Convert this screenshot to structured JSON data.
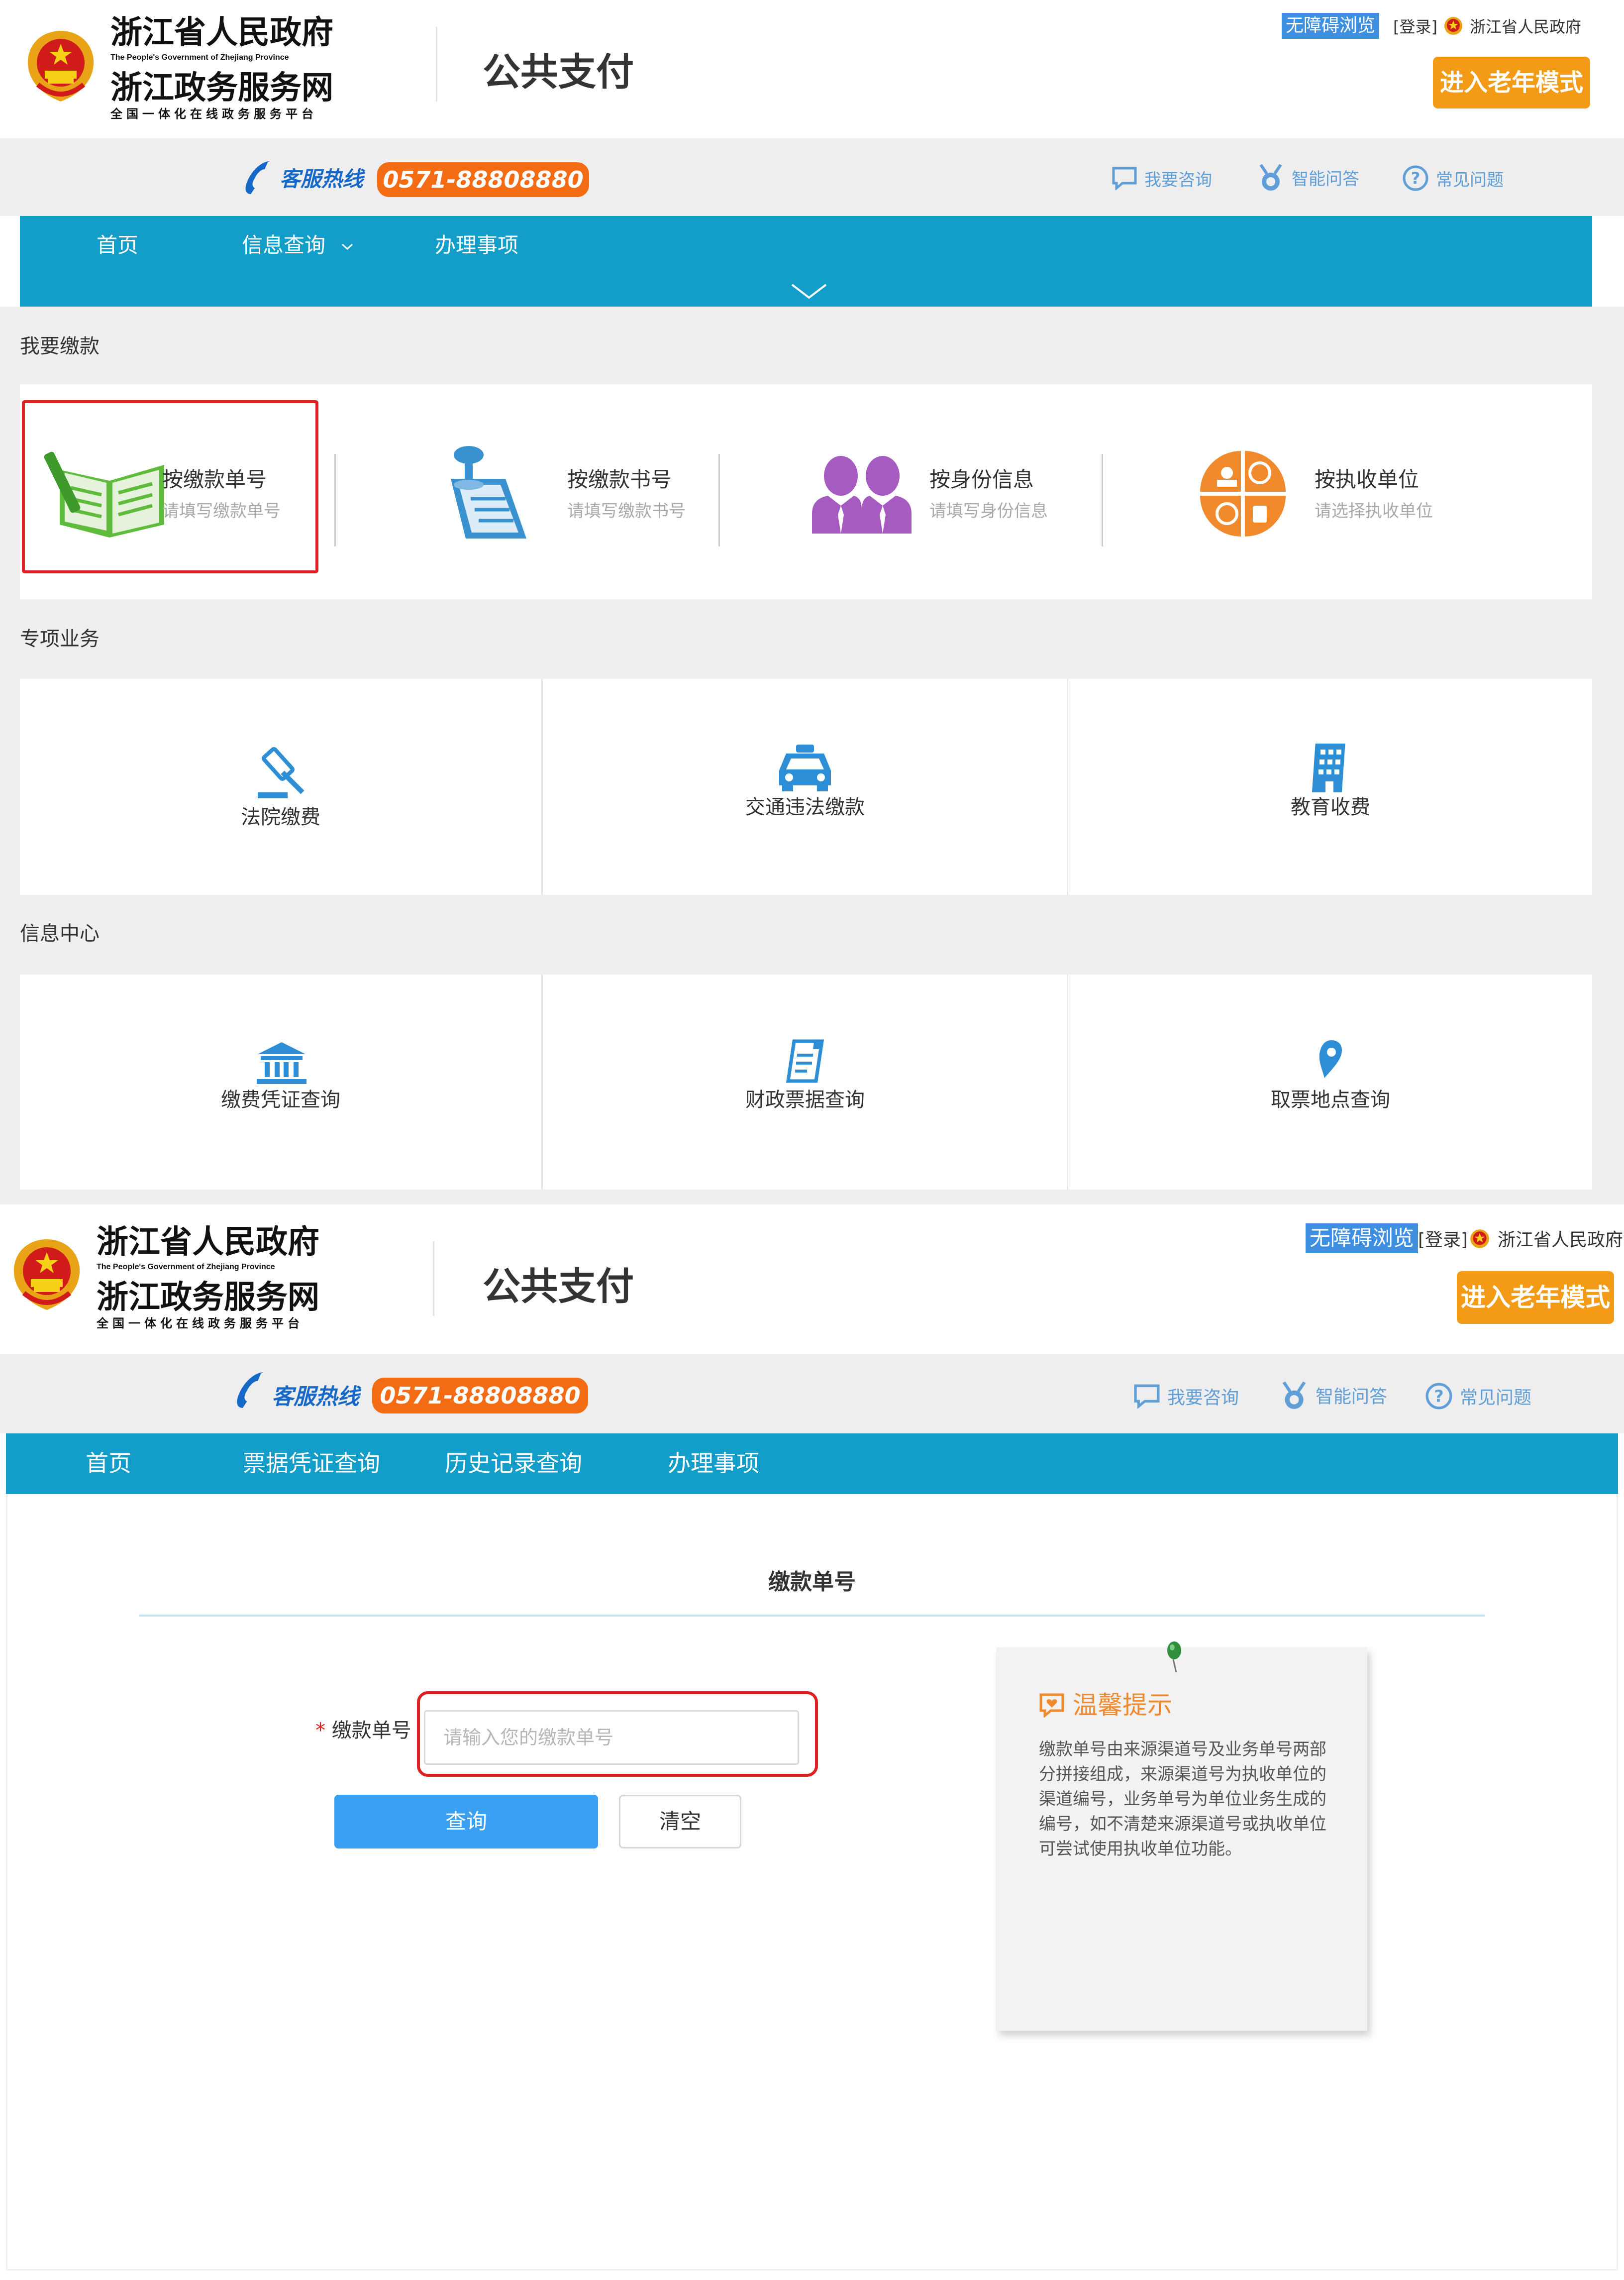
{
  "colors": {
    "nav_blue": "#139dc9",
    "hotline_orange": "#f36b12",
    "elder_orange": "#f39b16",
    "highlight_red": "#e02020",
    "primary_button": "#3aa0f2"
  },
  "header": {
    "gov_name": "浙江省人民政府",
    "gov_name_en": "The People's Government of Zhejiang Province",
    "portal_name": "浙江政务服务网",
    "portal_slogan": "全国一体化在线政务服务平台",
    "page_title": "公共支付",
    "accessibility": "无障碍浏览",
    "login": "[登录]",
    "gov_link": "浙江省人民政府",
    "elder_mode": "进入老年模式"
  },
  "subbar": {
    "hotline_label": "客服热线",
    "hotline_number": "0571-88808880",
    "links": [
      "我要咨询",
      "智能问答",
      "常见问题"
    ]
  },
  "screen1": {
    "nav": {
      "home": "首页",
      "info_query": "信息查询",
      "matters": "办理事项"
    },
    "pay_section": {
      "label": "我要缴款",
      "cards": [
        {
          "title": "按缴款单号",
          "sub": "请填写缴款单号",
          "icon": "notebook-pen-icon"
        },
        {
          "title": "按缴款书号",
          "sub": "请填写缴款书号",
          "icon": "pushpin-document-icon"
        },
        {
          "title": "按身份信息",
          "sub": "请填写身份信息",
          "icon": "people-icon"
        },
        {
          "title": "按执收单位",
          "sub": "请选择执收单位",
          "icon": "unit-quadrant-icon"
        }
      ]
    },
    "special_section": {
      "label": "专项业务",
      "tiles": [
        "法院缴费",
        "交通违法缴款",
        "教育收费"
      ]
    },
    "info_section": {
      "label": "信息中心",
      "tiles": [
        "缴费凭证查询",
        "财政票据查询",
        "取票地点查询"
      ]
    }
  },
  "screen2": {
    "nav": [
      "首页",
      "票据凭证查询",
      "历史记录查询",
      "办理事项"
    ],
    "form": {
      "heading": "缴款单号",
      "required_mark": "*",
      "field_label": "缴款单号",
      "placeholder": "请输入您的缴款单号",
      "value": "",
      "query_button": "查询",
      "clear_button": "清空"
    },
    "tips": {
      "title": "温馨提示",
      "body": "缴款单号由来源渠道号及业务单号两部分拼接组成，来源渠道号为执收单位的渠道编号，业务单号为单位业务生成的编号，如不清楚来源渠道号或执收单位可尝试使用执收单位功能。"
    }
  }
}
